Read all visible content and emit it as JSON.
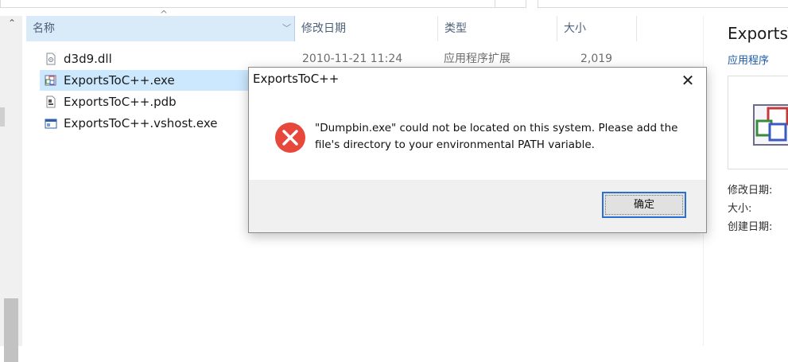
{
  "columns": {
    "name": "名称",
    "date": "修改日期",
    "type": "类型",
    "size": "大小"
  },
  "files": [
    {
      "name": "d3d9.dll",
      "date": "2010-11-21 11:24",
      "type": "应用程序扩展",
      "size": "2,019 KB",
      "icon": "dll-file-icon"
    },
    {
      "name": "ExportsToC++.exe",
      "date": "",
      "type": "",
      "size": "",
      "icon": "exe-file-icon",
      "selected": true
    },
    {
      "name": "ExportsToC++.pdb",
      "date": "",
      "type": "",
      "size": "",
      "icon": "pdb-file-icon"
    },
    {
      "name": "ExportsToC++.vshost.exe",
      "date": "",
      "type": "",
      "size": "",
      "icon": "vshost-exe-icon"
    }
  ],
  "preview": {
    "title": "ExportsT",
    "type": "应用程序",
    "modified_label": "修改日期:",
    "size_label": "大小:",
    "created_label": "创建日期:"
  },
  "dialog": {
    "title": "ExportsToC++",
    "message_line1": "\"Dumpbin.exe\" could not be located on this system.  Please add the",
    "message_line2": "file's directory to your environmental PATH variable.",
    "ok_label": "确定",
    "close_glyph": "✕"
  },
  "colors": {
    "header_selected_bg": "#d9ebf9",
    "row_selected_bg": "#cce8ff",
    "error_red": "#e8483b",
    "button_focus_border": "#2a6fd3"
  }
}
